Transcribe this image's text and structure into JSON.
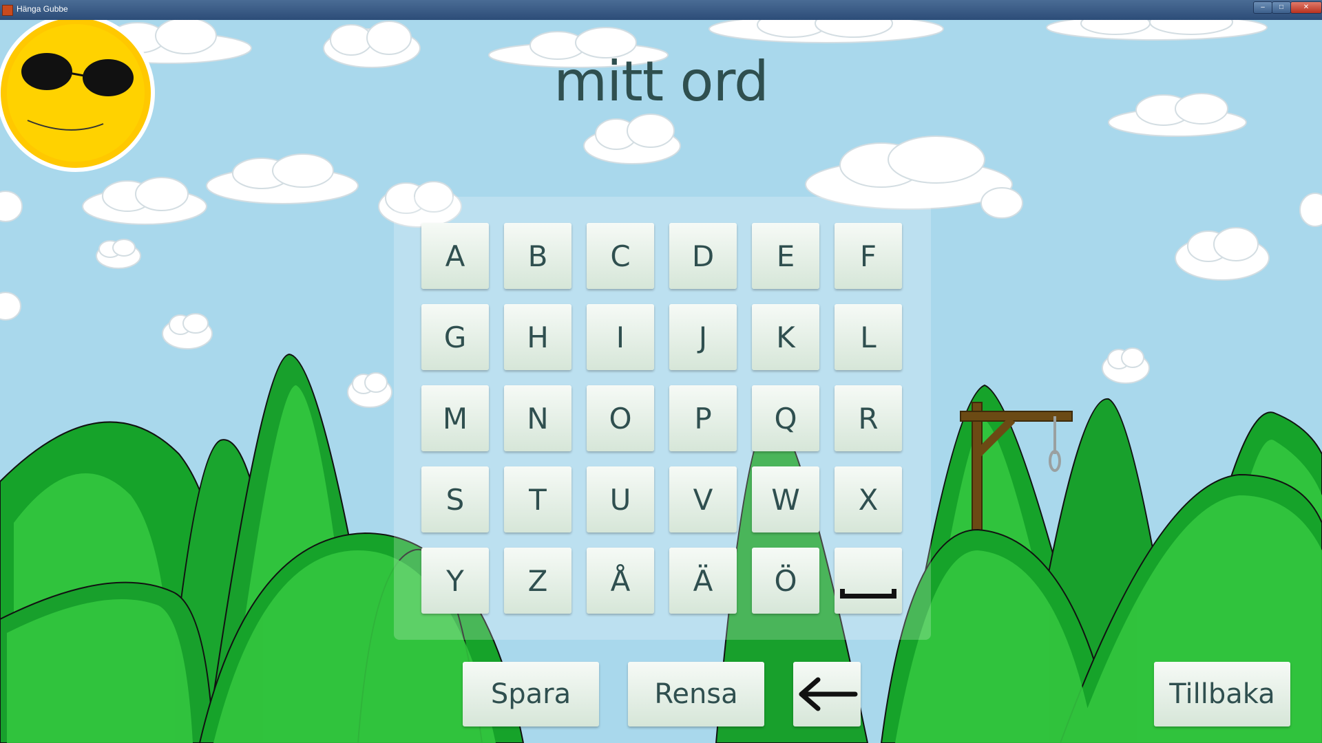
{
  "window": {
    "title": "Hänga Gubbe",
    "minimize_glyph": "–",
    "maximize_glyph": "□",
    "close_glyph": "✕"
  },
  "game": {
    "word": "mitt ord"
  },
  "keyboard": {
    "keys": [
      "A",
      "B",
      "C",
      "D",
      "E",
      "F",
      "G",
      "H",
      "I",
      "J",
      "K",
      "L",
      "M",
      "N",
      "O",
      "P",
      "Q",
      "R",
      "S",
      "T",
      "U",
      "V",
      "W",
      "X",
      "Y",
      "Z",
      "Å",
      "Ä",
      "Ö"
    ],
    "space_icon": "space-bar-icon"
  },
  "buttons": {
    "save": "Spara",
    "clear": "Rensa",
    "backspace_icon": "left-arrow-icon",
    "back": "Tillbaka"
  },
  "colors": {
    "sky": "#a9d8ec",
    "hill_dark": "#16a32a",
    "hill_light": "#33c63f",
    "sun": "#ffc800",
    "text": "#2f4f4f",
    "gallows": "#6b4a14"
  }
}
